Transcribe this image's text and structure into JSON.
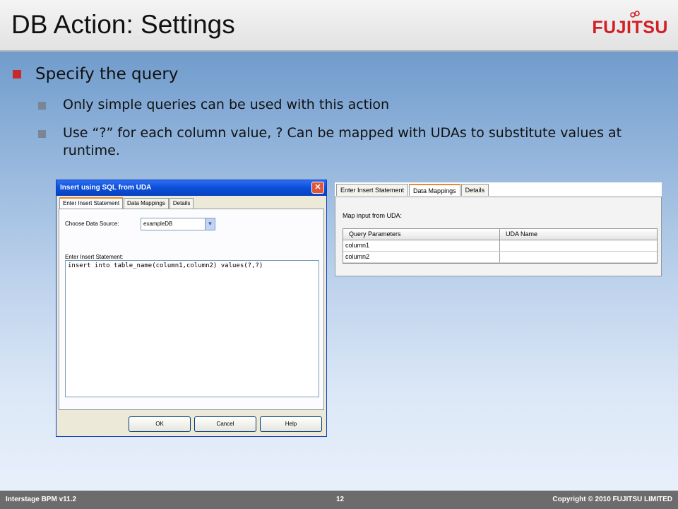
{
  "slide": {
    "title": "DB Action: Settings",
    "logo_text": "FUJITSU",
    "bullet_main": "Specify the query",
    "sub_bullets": [
      "Only simple queries can be used with this action",
      "Use “?” for each column value, ? Can be mapped with UDAs to substitute values at runtime."
    ]
  },
  "dialog": {
    "title": "Insert using SQL from UDA",
    "close_glyph": "✕",
    "tabs": [
      "Enter Insert Statement",
      "Data Mappings",
      "Details"
    ],
    "choose_label": "Choose Data Source:",
    "data_source_value": "exampleDB",
    "stmt_label": "Enter Insert Statement:",
    "stmt_value": "insert into table_name(column1,column2) values(?,?)",
    "buttons": {
      "ok": "OK",
      "cancel": "Cancel",
      "help": "Help"
    }
  },
  "mapping_panel": {
    "tabs": [
      "Enter Insert Statement",
      "Data Mappings",
      "Details"
    ],
    "map_label": "Map input from UDA:",
    "columns": [
      "Query Parameters",
      "UDA Name"
    ],
    "rows": [
      [
        "column1",
        ""
      ],
      [
        "column2",
        ""
      ]
    ]
  },
  "footer": {
    "left": "Interstage BPM v11.2",
    "page": "12",
    "right": "Copyright © 2010 FUJITSU LIMITED"
  },
  "colors": {
    "accent_red": "#c8292a",
    "title_blue": "#0a4fd8"
  }
}
